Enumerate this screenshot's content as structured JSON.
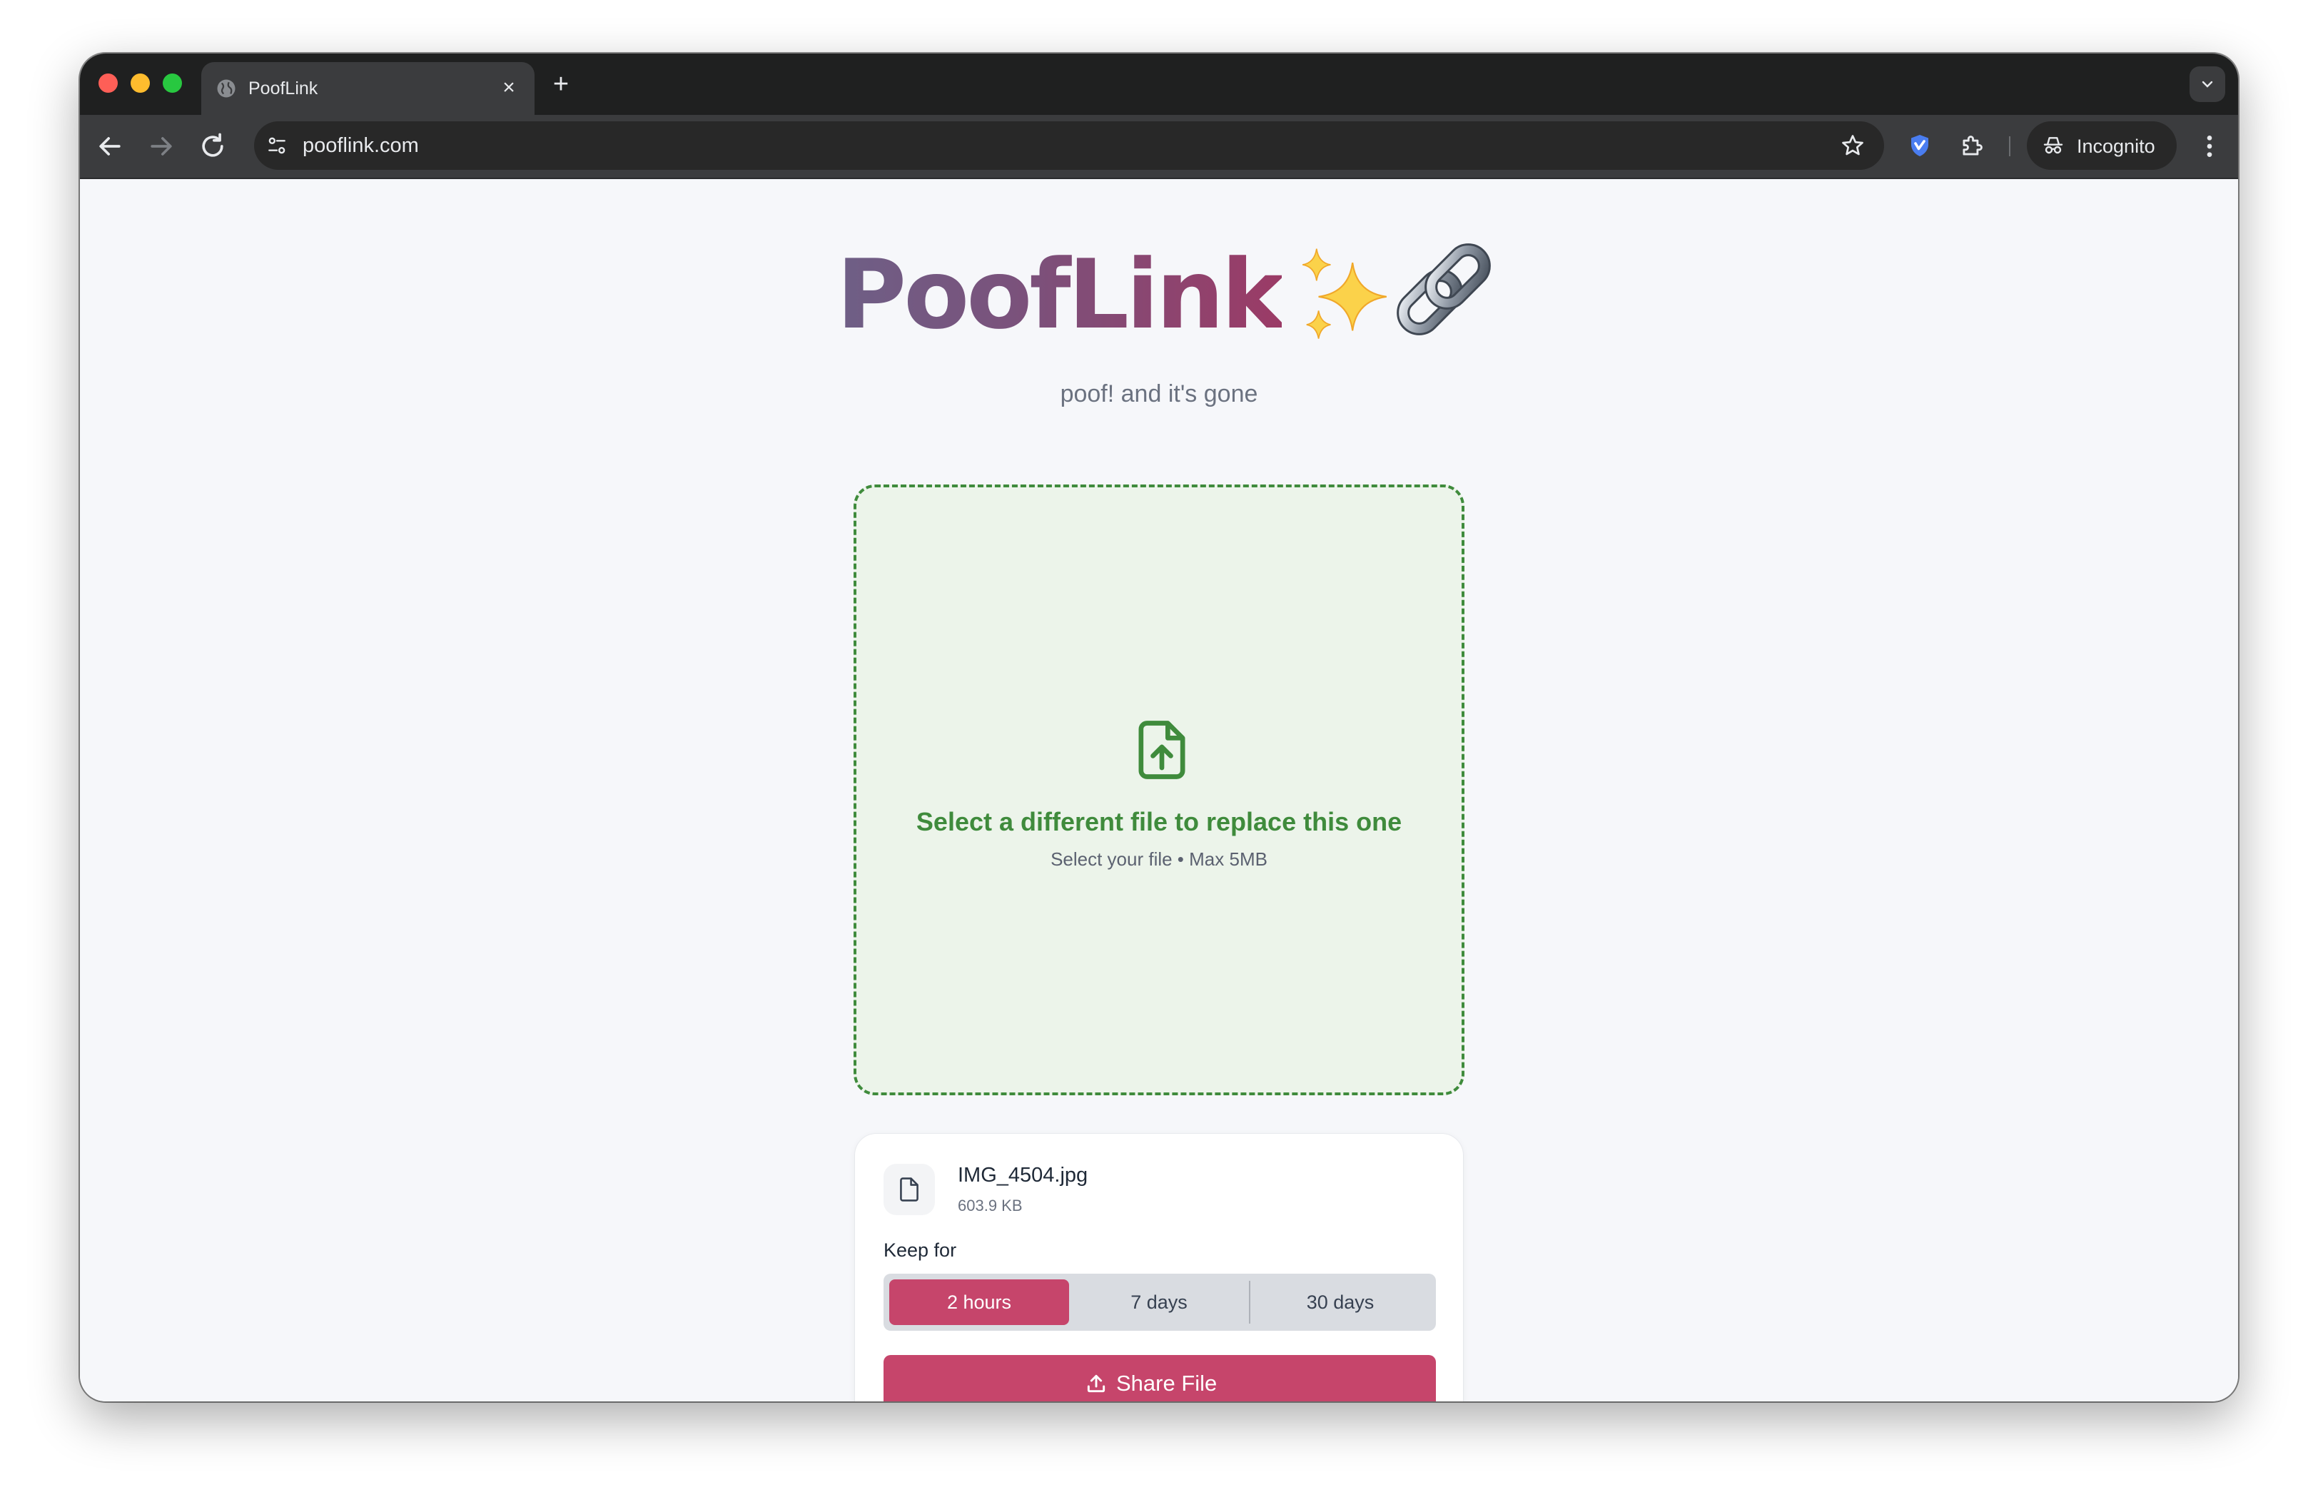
{
  "browser": {
    "tab_title": "PoofLink",
    "new_tab_symbol": "+",
    "close_symbol": "×",
    "url": "pooflink.com",
    "incognito_label": "Incognito"
  },
  "page": {
    "logo_text": "PoofLink",
    "tagline": "poof! and it's gone",
    "dropzone": {
      "title": "Select a different file to replace this one",
      "hint": "Select your file • Max 5MB"
    },
    "file": {
      "name": "IMG_4504.jpg",
      "size": "603.9 KB"
    },
    "keep_for": {
      "label": "Keep for",
      "options": [
        "2 hours",
        "7 days",
        "30 days"
      ],
      "selected": "2 hours"
    },
    "share_button": "Share File"
  },
  "colors": {
    "accent": "#c6456b",
    "success": "#3f8b3c",
    "dropzone_bg": "#ecf4ea"
  }
}
